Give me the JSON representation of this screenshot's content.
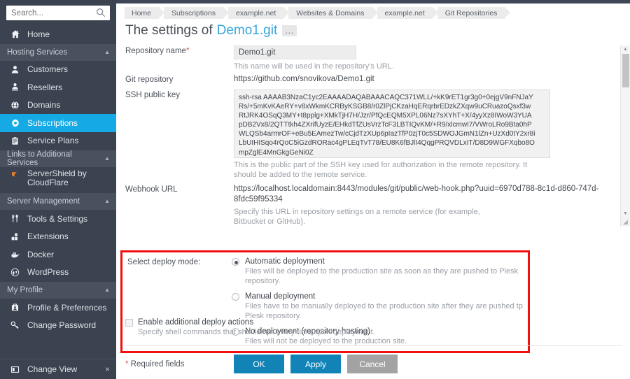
{
  "sidebar": {
    "search": {
      "placeholder": "Search...",
      "value": "",
      "icon": "search-icon"
    },
    "home": {
      "label": "Home",
      "icon": "home-icon"
    },
    "groups": [
      {
        "title": "Hosting Services",
        "items": [
          {
            "label": "Customers",
            "icon": "user-icon"
          },
          {
            "label": "Resellers",
            "icon": "reseller-icon"
          },
          {
            "label": "Domains",
            "icon": "globe-icon"
          },
          {
            "label": "Subscriptions",
            "icon": "gear-icon",
            "active": true
          },
          {
            "label": "Service Plans",
            "icon": "clipboard-icon"
          }
        ]
      },
      {
        "title": "Links to Additional Services",
        "items": [
          {
            "label": "ServerShield by CloudFlare",
            "icon": "cloudflare-icon"
          }
        ]
      },
      {
        "title": "Server Management",
        "items": [
          {
            "label": "Tools & Settings",
            "icon": "tools-icon"
          },
          {
            "label": "Extensions",
            "icon": "extensions-icon"
          },
          {
            "label": "Docker",
            "icon": "docker-icon"
          },
          {
            "label": "WordPress",
            "icon": "wordpress-icon"
          }
        ]
      },
      {
        "title": "My Profile",
        "items": [
          {
            "label": "Profile & Preferences",
            "icon": "profile-icon"
          },
          {
            "label": "Change Password",
            "icon": "key-icon"
          }
        ]
      }
    ],
    "bottom": {
      "label": "Change View",
      "icon": "layout-icon",
      "close": "×"
    }
  },
  "breadcrumb": [
    "Home",
    "Subscriptions",
    "example.net",
    "Websites & Domains",
    "example.net",
    "Git Repositories"
  ],
  "page": {
    "title_prefix": "The settings of",
    "repo_name": "Demo1.git",
    "more_label": "…"
  },
  "form": {
    "repository_name": {
      "label": "Repository name",
      "required_mark": "*",
      "value": "Demo1.git",
      "hint": "This name will be used in the repository's URL."
    },
    "git_repository": {
      "label": "Git repository",
      "value": "https://github.com/snovikova/Demo1.git"
    },
    "ssh_public_key": {
      "label": "SSH public key",
      "value": "ssh-rsa\nAAAAB3NzaC1yc2EAAAADAQABAAACAQC371WLL/+kK9rET1gr3g0+0ejgV9nFNJaYRs/+5mKvKAeRY+v8xWkmKCRByKSGB8/r0ZlPjCKzaHqERqrbrEDzkZXqw9uCRuazoQsxf3wRtJRK4OSqQ3MY+t8pplg+XMkTjH7H/Jzr/PfQcEQM5XPL06Nz7sXYhT+X/4yyXz8IWoW3YUApDB2Vx8/2QTTtkh4ZXrifUyzE/EHkdTfZUsVrzTcF3LBTIQvKM/+R9/xlcmwI7/VWroLRo9Bta0hPWLQSb4armrOF+eBu5EAmezTw/cCjdTzXUp6pIazTfP0zjT0c5SDWOJGmN1lZn+UzXd0tY2xr8iLbUIHISqo4rQoC5iGzdRORac4gPLEqTvT78/EU8K6fBJlI4QqgPRQVDLxIT/D8D9WGFXqbo8OmpZglE4MnGkgGeNi0Z",
      "hint": "This is the public part of the SSH key used for authorization in the remote repository. It should be added to the remote service."
    },
    "webhook_url": {
      "label": "Webhook URL",
      "value": "https://localhost.localdomain:8443/modules/git/public/web-hook.php?uuid=6970d788-8c1d-d860-747d-8fdc59f95334",
      "hint": "Specify this URL in repository settings on a remote service (for example, Bitbucket or GitHub)."
    },
    "deploy_mode": {
      "label": "Select deploy mode:",
      "options": [
        {
          "label": "Automatic deployment",
          "desc": "Files will be deployed to the production site as soon as they are pushed to Plesk repository.",
          "selected": true
        },
        {
          "label": "Manual deployment",
          "desc": "Files have to be manually deployed to the production site after they are pushed tp Plesk repository.",
          "selected": false
        },
        {
          "label": "No deployment (repository hosting)",
          "desc": "Files will not be deployed to the production site.",
          "selected": false
        }
      ]
    },
    "additional_actions": {
      "label": "Enable additional deploy actions",
      "checked": false,
      "desc": "Specify shell commands that should run every time upon deployment."
    }
  },
  "footer": {
    "required_mark": "*",
    "required_note": " Required fields",
    "ok_label": "OK",
    "apply_label": "Apply",
    "cancel_label": "Cancel"
  },
  "colors": {
    "sidebar_bg": "#3b4351",
    "sidebar_group_bg": "#49515f",
    "accent_active": "#15a9e5",
    "link_blue": "#34a5dd",
    "button_primary": "#1183b6",
    "button_secondary": "#a3a3a3",
    "highlight_box": "#f01010",
    "required_red": "#d9534f"
  }
}
